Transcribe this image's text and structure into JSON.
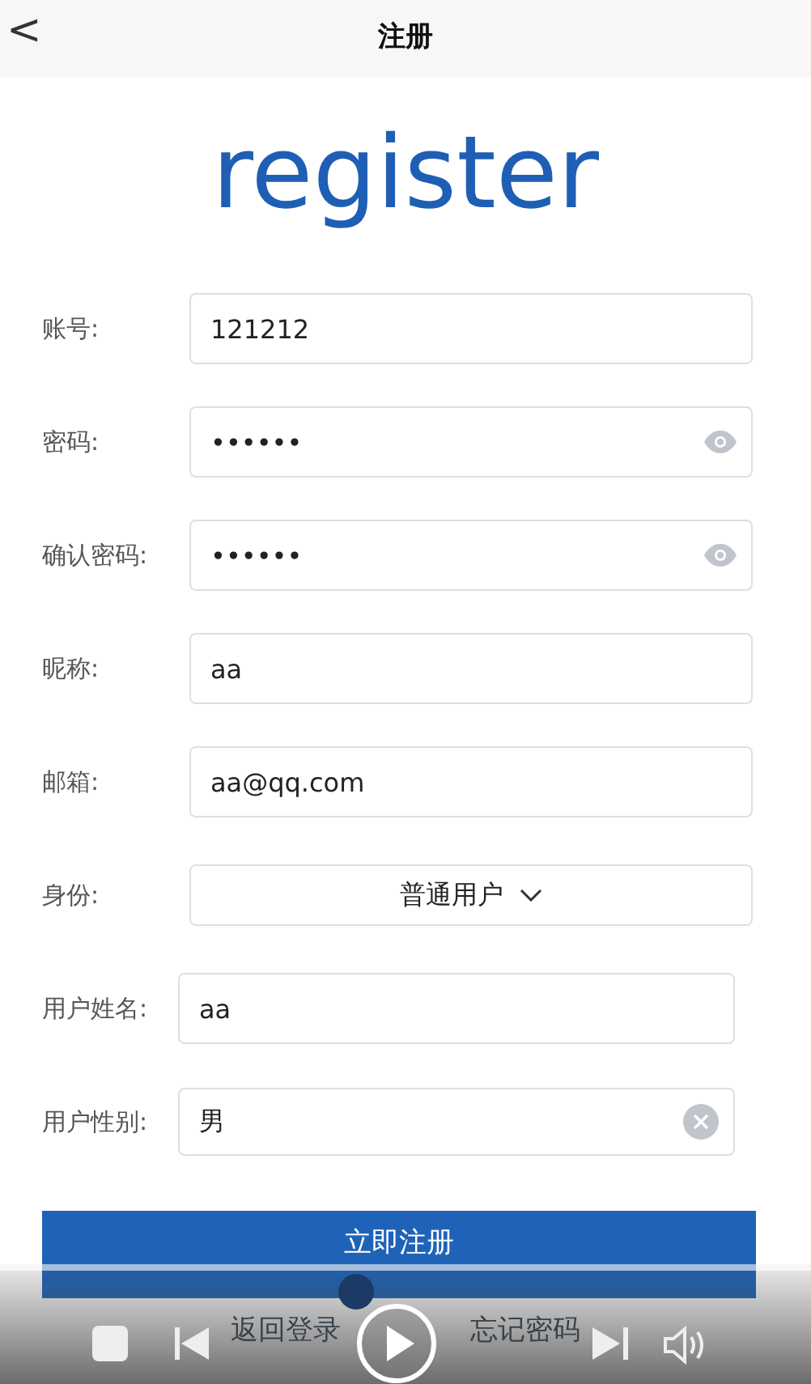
{
  "header": {
    "back": "<",
    "title": "注册"
  },
  "logo": "register",
  "fields": [
    {
      "kind": "text",
      "label": "账号:",
      "value": "121212"
    },
    {
      "kind": "password",
      "label": "密码:",
      "value": "••••••"
    },
    {
      "kind": "password",
      "label": "确认密码:",
      "value": "••••••"
    },
    {
      "kind": "text",
      "label": "昵称:",
      "value": "aa"
    },
    {
      "kind": "text",
      "label": "邮箱:",
      "value": "aa@qq.com"
    },
    {
      "kind": "select",
      "label": "身份:",
      "value": "普通用户"
    },
    {
      "kind": "text-narrow",
      "label": "用户姓名:",
      "value": "aa"
    },
    {
      "kind": "clearable",
      "label": "用户性别:",
      "value": "男"
    }
  ],
  "submit": "立即注册",
  "links": [
    "返回登录",
    "忘记密码"
  ],
  "player": {
    "level": 0.44
  }
}
